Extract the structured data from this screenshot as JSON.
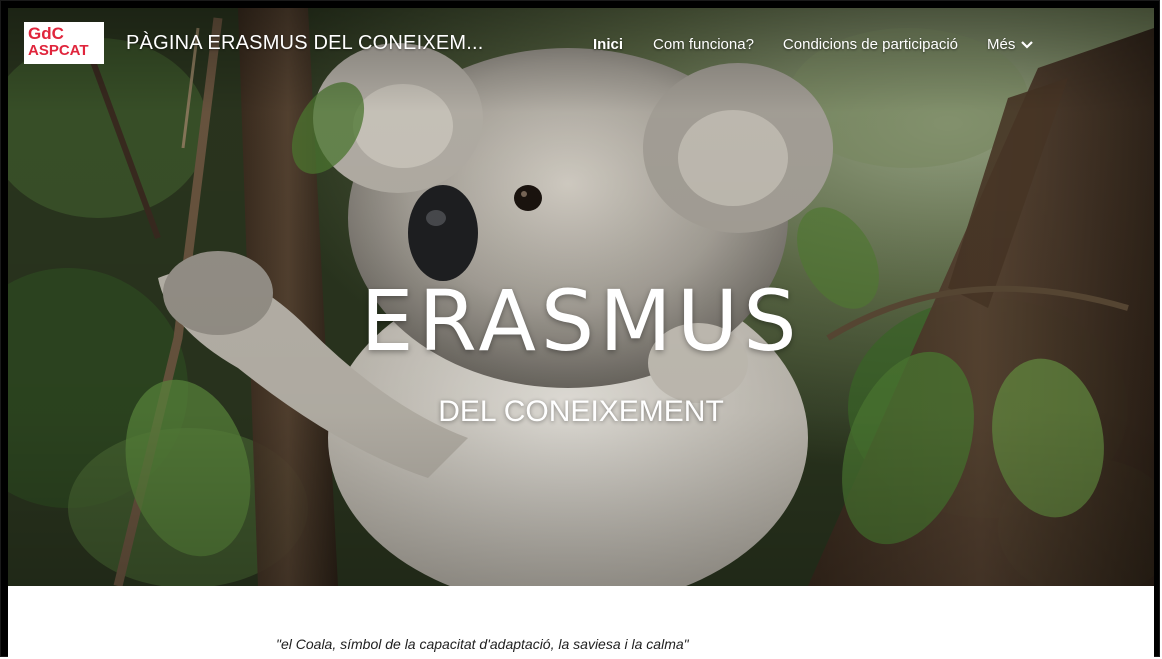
{
  "logo": {
    "line1": "GdC",
    "line2": "ASPCAT"
  },
  "header": {
    "site_title": "PÀGINA ERASMUS DEL CONEIXEM..."
  },
  "nav": {
    "items": [
      {
        "label": "Inici"
      },
      {
        "label": "Com funciona?"
      },
      {
        "label": "Condicions de participació"
      }
    ],
    "more_label": "Més"
  },
  "hero": {
    "title": "ERASMUS",
    "subtitle": "DEL CONEIXEMENT",
    "background_icon": "koala-photo"
  },
  "content": {
    "quote": "\"el Coala, símbol de la capacitat d'adaptació, la saviesa i la calma\""
  },
  "colors": {
    "logo_text": "#e0253c",
    "nav_text": "#ffffff",
    "quote_text": "#212121"
  }
}
